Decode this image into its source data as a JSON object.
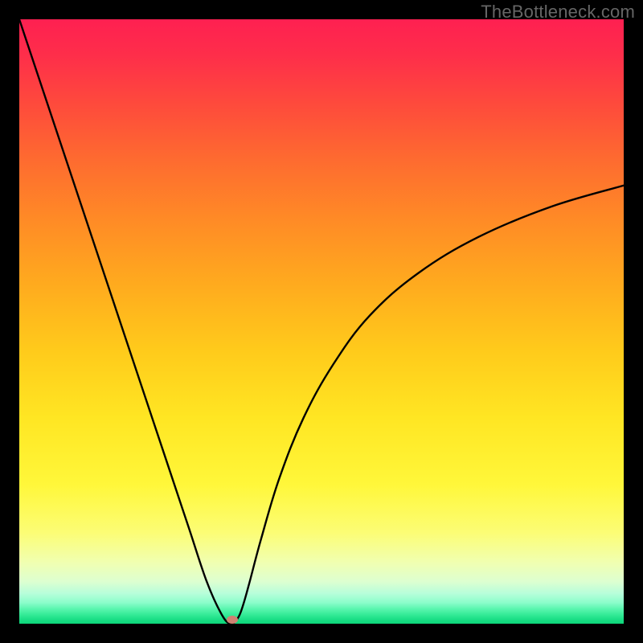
{
  "watermark": "TheBottleneck.com",
  "colors": {
    "frame_bg": "#000000",
    "curve": "#000000",
    "marker": "#cf8272",
    "watermark_text": "#666666"
  },
  "chart_data": {
    "type": "line",
    "title": "",
    "xlabel": "",
    "ylabel": "",
    "xlim": [
      0,
      100
    ],
    "ylim": [
      0,
      100
    ],
    "grid": false,
    "legend": false,
    "series": [
      {
        "name": "bottleneck-curve",
        "x": [
          0,
          4,
          8,
          12,
          16,
          20,
          24,
          28,
          31,
          33.5,
          35,
          36.2,
          37,
          38,
          40,
          43,
          47,
          52,
          58,
          66,
          76,
          88,
          100
        ],
        "y": [
          100,
          88,
          76,
          64,
          52,
          40,
          28,
          16,
          7,
          1.5,
          0,
          1,
          3,
          6.5,
          14,
          24,
          34,
          43,
          51,
          58,
          64,
          69,
          72.5
        ]
      }
    ],
    "marker": {
      "x": 35.2,
      "y": 0.6
    },
    "gradient_stops": [
      {
        "pct": 0,
        "color": "#fe2051"
      },
      {
        "pct": 6,
        "color": "#fe2e4a"
      },
      {
        "pct": 14,
        "color": "#fe4a3c"
      },
      {
        "pct": 23,
        "color": "#fe6a30"
      },
      {
        "pct": 33,
        "color": "#ff8a26"
      },
      {
        "pct": 44,
        "color": "#ffab1e"
      },
      {
        "pct": 55,
        "color": "#ffcb1b"
      },
      {
        "pct": 66,
        "color": "#ffe623"
      },
      {
        "pct": 77,
        "color": "#fff73a"
      },
      {
        "pct": 85,
        "color": "#fcfd76"
      },
      {
        "pct": 90,
        "color": "#f0ffb2"
      },
      {
        "pct": 93,
        "color": "#ddffd0"
      },
      {
        "pct": 95,
        "color": "#b7feda"
      },
      {
        "pct": 96.5,
        "color": "#8cfdcb"
      },
      {
        "pct": 97.5,
        "color": "#5cf6b0"
      },
      {
        "pct": 98.5,
        "color": "#35eb97"
      },
      {
        "pct": 99.2,
        "color": "#1de087"
      },
      {
        "pct": 100,
        "color": "#0cd579"
      }
    ]
  }
}
